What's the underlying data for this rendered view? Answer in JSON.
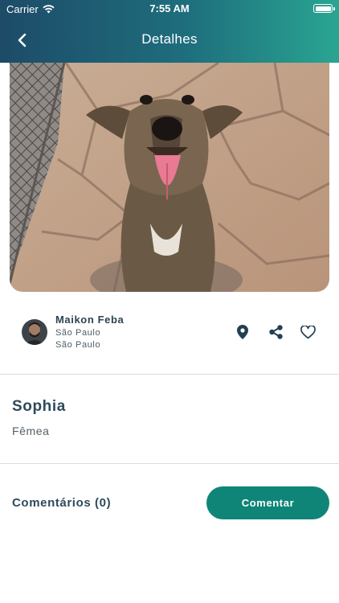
{
  "status_bar": {
    "carrier": "Carrier",
    "time": "7:55 AM",
    "icons": [
      "wifi-icon",
      "battery-icon"
    ]
  },
  "nav": {
    "title": "Detalhes",
    "back_icon": "chevron-left-icon"
  },
  "pet_photo": {
    "subject": "dog"
  },
  "owner": {
    "name": "Maikon Feba",
    "city": "São Paulo",
    "state": "São Paulo"
  },
  "actions": [
    "location-pin-icon",
    "share-icon",
    "heart-icon"
  ],
  "pet": {
    "name": "Sophia",
    "sex": "Fêmea"
  },
  "comments": {
    "label": "Comentários (0)",
    "button_label": "Comentar"
  },
  "colors": {
    "header_start": "#1d4b68",
    "header_end": "#2aa592",
    "accent": "#0f8577",
    "text_dark": "#2e4a5a"
  }
}
